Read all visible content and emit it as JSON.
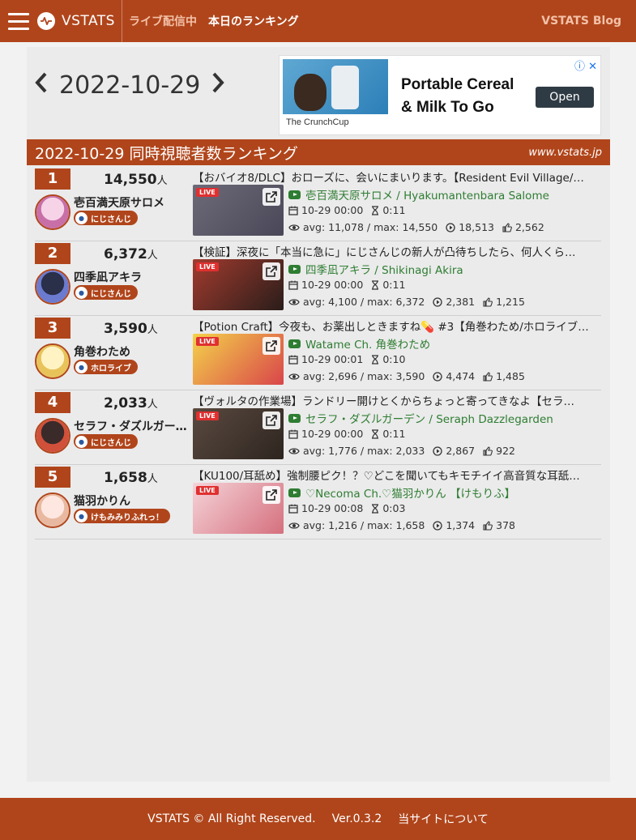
{
  "nav": {
    "brand": "VSTATS",
    "links": [
      "ライブ配信中",
      "本日のランキング"
    ],
    "right": "VSTATS Blog"
  },
  "date_nav": {
    "date": "2022-10-29"
  },
  "ad": {
    "title_line1": "Portable Cereal",
    "title_line2": "& Milk To Go",
    "button": "Open",
    "brand": "The CrunchCup"
  },
  "ranking": {
    "title": "2022-10-29 同時視聴者数ランキング",
    "site": "www.vstats.jp",
    "unit": "人",
    "items": [
      {
        "rank": "1",
        "viewers": "14,550",
        "name": "壱百満天原サロメ",
        "group": "にじさんじ",
        "title": "【おバイオ8/DLC】おローズに、会いにまいります。【Resident Evil Village/…",
        "channel": "壱百満天原サロメ / Hyakumantenbara Salome",
        "date": "10-29 00:00",
        "duration": "0:11",
        "stats": "avg: 11,078 / max: 14,550",
        "views": "18,513",
        "likes": "2,562",
        "live": "LIVE"
      },
      {
        "rank": "2",
        "viewers": "6,372",
        "name": "四季凪アキラ",
        "group": "にじさんじ",
        "title": "【検証】深夜に「本当に急に」にじさんじの新人が凸待ちしたら、何人くら…",
        "channel": "四季凪アキラ / Shikinagi Akira",
        "date": "10-29 00:00",
        "duration": "0:11",
        "stats": "avg: 4,100 / max: 6,372",
        "views": "2,381",
        "likes": "1,215",
        "live": "LIVE"
      },
      {
        "rank": "3",
        "viewers": "3,590",
        "name": "角巻わため",
        "group": "ホロライブ",
        "title": "【Potion Craft】今夜も、お薬出しときますね💊 #3【角巻わため/ホロライブ…",
        "channel": "Watame Ch. 角巻わため",
        "date": "10-29 00:01",
        "duration": "0:10",
        "stats": "avg: 2,696 / max: 3,590",
        "views": "4,474",
        "likes": "1,485",
        "live": "LIVE"
      },
      {
        "rank": "4",
        "viewers": "2,033",
        "name": "セラフ・ダズルガーデン",
        "group": "にじさんじ",
        "title": "【ヴォルタの作業場】ランドリー開けとくからちょっと寄ってきなよ【セラ…",
        "channel": "セラフ・ダズルガーデン / Seraph Dazzlegarden",
        "date": "10-29 00:00",
        "duration": "0:11",
        "stats": "avg: 1,776 / max: 2,033",
        "views": "2,867",
        "likes": "922",
        "live": "LIVE"
      },
      {
        "rank": "5",
        "viewers": "1,658",
        "name": "猫羽かりん",
        "group": "けもみみりふれっ！",
        "title": "【KU100/耳舐め】強制腰ピク！？♡どこを聞いてもキモチイイ高音質な耳舐…",
        "channel": "♡Necoma Ch.♡猫羽かりん 【けもりふ】",
        "date": "10-29 00:08",
        "duration": "0:03",
        "stats": "avg: 1,216 / max: 1,658",
        "views": "1,374",
        "likes": "378",
        "live": "LIVE"
      }
    ]
  },
  "footer": {
    "copyright": "VSTATS © All Right Reserved.",
    "version": "Ver.0.3.2",
    "about": "当サイトについて"
  },
  "colors": {
    "brand": "#b0451b",
    "channel": "#2e7d32"
  }
}
